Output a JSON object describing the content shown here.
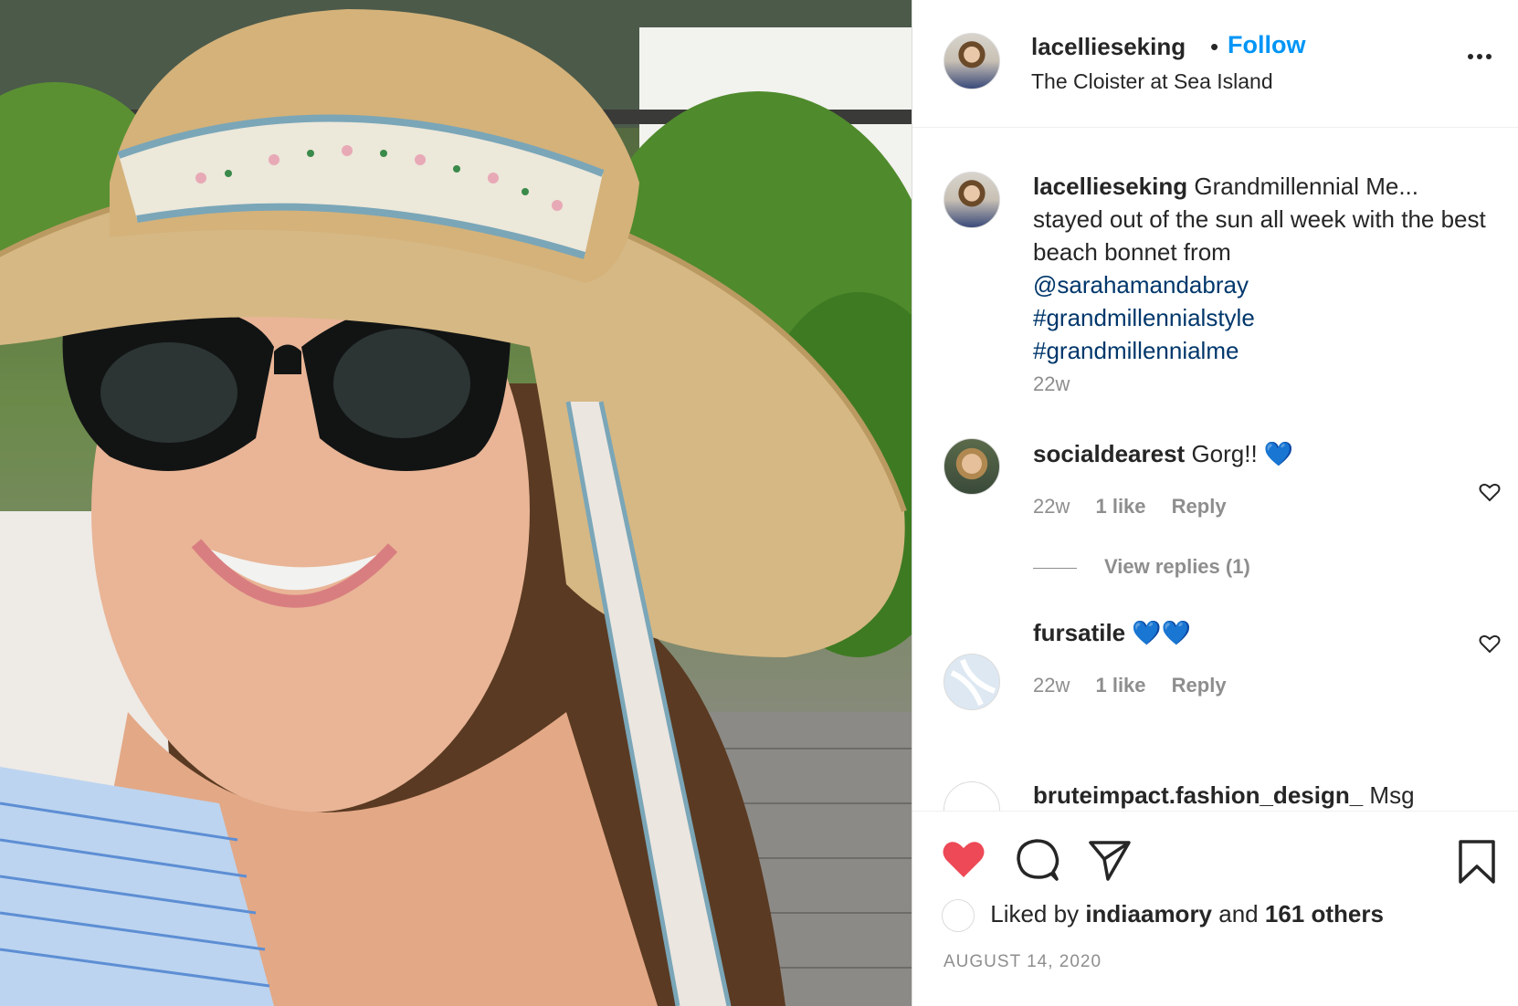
{
  "post": {
    "username": "lacellieseking",
    "follow_label": "Follow",
    "separator": "•",
    "location": "The Cloister at Sea Island"
  },
  "caption": {
    "username": "lacellieseking",
    "text": "Grandmillennial Me... stayed out of the sun all week with the best beach bonnet from",
    "mention": "@sarahamandabray",
    "hashtags": [
      "#grandmillennialstyle",
      "#grandmillennialme"
    ],
    "time": "22w"
  },
  "comments": [
    {
      "username": "socialdearest",
      "text": "Gorg!! 💙",
      "time": "22w",
      "likes": "1 like",
      "reply": "Reply",
      "view_replies": "View replies (1)"
    },
    {
      "username": "fursatile",
      "text": "💙💙",
      "time": "22w",
      "likes": "1 like",
      "reply": "Reply"
    },
    {
      "username": "bruteimpact.fashion_design_",
      "text": "Msg"
    }
  ],
  "likes": {
    "prefix": "Liked by",
    "user": "indiaamory",
    "joiner": "and",
    "others": "161 others"
  },
  "date": "AUGUST 14, 2020",
  "icons": {
    "like": "heart-filled-icon",
    "comment": "comment-bubble-icon",
    "share": "paper-plane-icon",
    "save": "bookmark-icon",
    "more": "more-options-icon"
  },
  "colors": {
    "like_red": "#ed4956",
    "link_blue": "#0095f6",
    "tag_blue": "#00376b",
    "muted": "#8e8e8e"
  }
}
